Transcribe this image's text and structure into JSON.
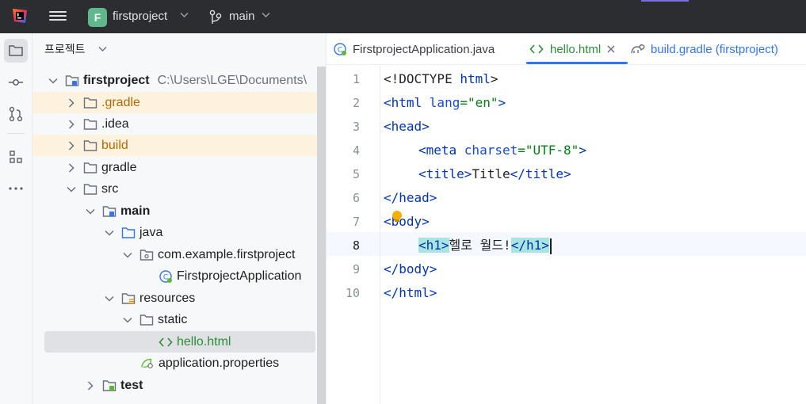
{
  "titlebar": {
    "project_initial": "F",
    "project_name": "firstproject",
    "branch": "main",
    "colors": {
      "background": "#2b2d30",
      "badge": "#5fb88b"
    }
  },
  "toolstrip": {
    "items": [
      {
        "icon": "folder-icon",
        "active": true
      },
      {
        "icon": "commit-icon"
      },
      {
        "icon": "pull-requests-icon"
      },
      {
        "icon": "structure-icon"
      },
      {
        "icon": "more-icon"
      }
    ]
  },
  "project_panel": {
    "title": "프로젝트",
    "tree": [
      {
        "label": "firstproject",
        "path": "C:\\Users\\LGE\\Documents\\",
        "expanded": true,
        "icon": "module-folder-icon"
      },
      {
        "label": ".gradle",
        "excluded": true,
        "icon": "folder-icon"
      },
      {
        "label": ".idea",
        "icon": "folder-icon"
      },
      {
        "label": "build",
        "excluded": true,
        "icon": "folder-icon"
      },
      {
        "label": "gradle",
        "icon": "folder-icon"
      },
      {
        "label": "src",
        "expanded": true,
        "icon": "folder-icon"
      },
      {
        "label": "main",
        "expanded": true,
        "icon": "module-folder-icon"
      },
      {
        "label": "java",
        "expanded": true,
        "icon": "source-folder-icon"
      },
      {
        "label": "com.example.firstproject",
        "expanded": true,
        "icon": "package-icon"
      },
      {
        "label": "FirstprojectApplication",
        "icon": "spring-class-icon"
      },
      {
        "label": "resources",
        "expanded": true,
        "icon": "resources-folder-icon"
      },
      {
        "label": "static",
        "expanded": true,
        "icon": "folder-icon"
      },
      {
        "label": "hello.html",
        "selected": true,
        "icon": "html-icon"
      },
      {
        "label": "application.properties",
        "icon": "properties-icon"
      },
      {
        "label": "test",
        "icon": "module-folder-icon"
      }
    ]
  },
  "editor": {
    "tabs": [
      {
        "label": "FirstprojectApplication.java",
        "icon": "spring-class-icon"
      },
      {
        "label": "hello.html",
        "icon": "html-icon",
        "active": true
      },
      {
        "label": "build.gradle (firstproject)",
        "icon": "gradle-icon"
      }
    ],
    "line_numbers": [
      "1",
      "2",
      "3",
      "4",
      "5",
      "6",
      "7",
      "8",
      "9",
      "10"
    ],
    "current_line": "8",
    "code": {
      "l1_a": "<!DOCTYPE ",
      "l1_b": "html",
      "l1_c": ">",
      "l2_a": "<html ",
      "l2_b": "lang",
      "l2_c": "=",
      "l2_d": "\"en\"",
      "l2_e": ">",
      "l3": "<head>",
      "l4_a": "<meta ",
      "l4_b": "charset",
      "l4_c": "=",
      "l4_d": "\"UTF-8\"",
      "l4_e": ">",
      "l5_a": "<title>",
      "l5_b": "Title",
      "l5_c": "</title>",
      "l6": "</head>",
      "l7_a": "<",
      "l7_b": "body>",
      "l8_a": "<h1>",
      "l8_b": "헬로 월드!",
      "l8_c": "</h1>",
      "l9": "</body>",
      "l10": "</html>"
    },
    "colors": {
      "tag": "#0033b3",
      "string": "#067d17",
      "match_highlight": "#a9e5e0",
      "tab_underline": "#3574f0"
    }
  }
}
